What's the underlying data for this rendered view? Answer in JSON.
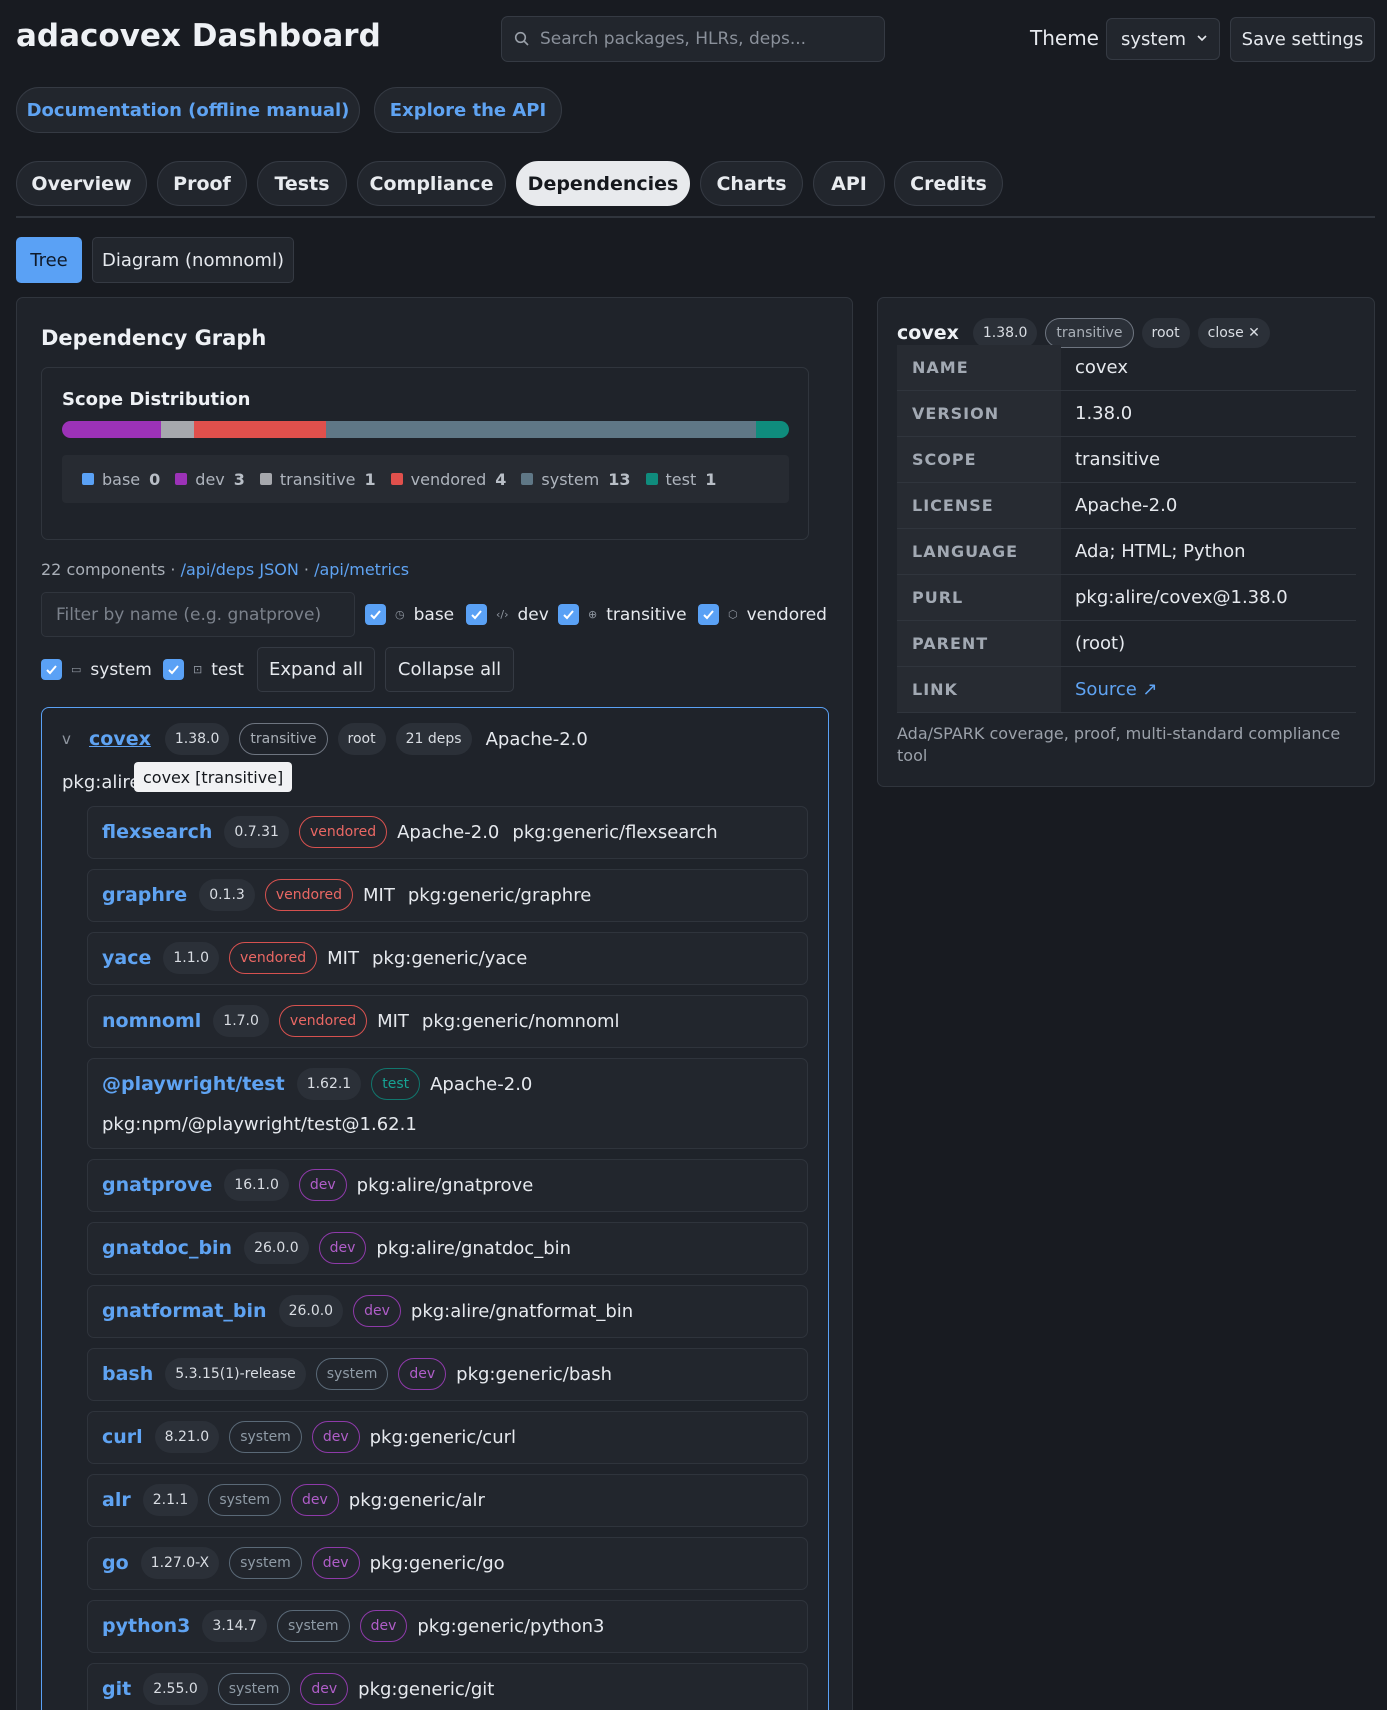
{
  "header": {
    "title": "adacovex Dashboard",
    "search_placeholder": "Search packages, HLRs, deps...",
    "theme_label": "Theme",
    "theme_value": "system",
    "save_label": "Save settings"
  },
  "links": {
    "docs": "Documentation (offline manual)",
    "api": "Explore the API"
  },
  "tabs": [
    "Overview",
    "Proof",
    "Tests",
    "Compliance",
    "Dependencies",
    "Charts",
    "API",
    "Credits"
  ],
  "active_tab": "Dependencies",
  "subtabs": [
    "Tree",
    "Diagram (nomnoml)"
  ],
  "graph": {
    "title": "Dependency Graph",
    "scope_title": "Scope Distribution",
    "scopes": [
      {
        "name": "base",
        "count": "0",
        "color": "#5aa1f5"
      },
      {
        "name": "dev",
        "count": "3",
        "color": "#9c32b8"
      },
      {
        "name": "transitive",
        "count": "1",
        "color": "#a6a8ad"
      },
      {
        "name": "vendored",
        "count": "4",
        "color": "#e0504c"
      },
      {
        "name": "system",
        "count": "13",
        "color": "#5f7786"
      },
      {
        "name": "test",
        "count": "1",
        "color": "#0f8c7d"
      }
    ],
    "components_text": "22 components",
    "sep": "·",
    "deps_json_link": "/api/deps JSON",
    "metrics_link": "/api/metrics",
    "filter_placeholder": "Filter by name (e.g. gnatprove)",
    "filters": [
      "base",
      "dev",
      "transitive",
      "vendored",
      "system",
      "test"
    ],
    "expand_label": "Expand all",
    "collapse_label": "Collapse all"
  },
  "root": {
    "caret": "v",
    "name": "covex",
    "version": "1.38.0",
    "scope": "transitive",
    "role": "root",
    "deps": "21 deps",
    "license": "Apache-2.0",
    "purl": "pkg:alire",
    "tooltip": "covex [transitive]"
  },
  "deps": [
    {
      "name": "flexsearch",
      "version": "0.7.31",
      "chips": [
        "vendored"
      ],
      "license": "Apache-2.0",
      "purl": "pkg:generic/flexsearch"
    },
    {
      "name": "graphre",
      "version": "0.1.3",
      "chips": [
        "vendored"
      ],
      "license": "MIT",
      "purl": "pkg:generic/graphre"
    },
    {
      "name": "yace",
      "version": "1.1.0",
      "chips": [
        "vendored"
      ],
      "license": "MIT",
      "purl": "pkg:generic/yace"
    },
    {
      "name": "nomnoml",
      "version": "1.7.0",
      "chips": [
        "vendored"
      ],
      "license": "MIT",
      "purl": "pkg:generic/nomnoml"
    },
    {
      "name": "@playwright/test",
      "version": "1.62.1",
      "chips": [
        "test"
      ],
      "license": "Apache-2.0",
      "purl": "pkg:npm/@playwright/test@1.62.1"
    },
    {
      "name": "gnatprove",
      "version": "16.1.0",
      "chips": [
        "dev"
      ],
      "license": "",
      "purl": "pkg:alire/gnatprove"
    },
    {
      "name": "gnatdoc_bin",
      "version": "26.0.0",
      "chips": [
        "dev"
      ],
      "license": "",
      "purl": "pkg:alire/gnatdoc_bin"
    },
    {
      "name": "gnatformat_bin",
      "version": "26.0.0",
      "chips": [
        "dev"
      ],
      "license": "",
      "purl": "pkg:alire/gnatformat_bin"
    },
    {
      "name": "bash",
      "version": "5.3.15(1)-release",
      "chips": [
        "system",
        "dev"
      ],
      "license": "",
      "purl": "pkg:generic/bash"
    },
    {
      "name": "curl",
      "version": "8.21.0",
      "chips": [
        "system",
        "dev"
      ],
      "license": "",
      "purl": "pkg:generic/curl"
    },
    {
      "name": "alr",
      "version": "2.1.1",
      "chips": [
        "system",
        "dev"
      ],
      "license": "",
      "purl": "pkg:generic/alr"
    },
    {
      "name": "go",
      "version": "1.27.0-X",
      "chips": [
        "system",
        "dev"
      ],
      "license": "",
      "purl": "pkg:generic/go"
    },
    {
      "name": "python3",
      "version": "3.14.7",
      "chips": [
        "system",
        "dev"
      ],
      "license": "",
      "purl": "pkg:generic/python3"
    },
    {
      "name": "git",
      "version": "2.55.0",
      "chips": [
        "system",
        "dev"
      ],
      "license": "",
      "purl": "pkg:generic/git"
    }
  ],
  "detail": {
    "name": "covex",
    "version": "1.38.0",
    "scope": "transitive",
    "role": "root",
    "close": "close ✕",
    "rows": [
      {
        "k": "NAME",
        "v": "covex"
      },
      {
        "k": "VERSION",
        "v": "1.38.0"
      },
      {
        "k": "SCOPE",
        "v": "transitive"
      },
      {
        "k": "LICENSE",
        "v": "Apache-2.0"
      },
      {
        "k": "LANGUAGE",
        "v": "Ada; HTML; Python"
      },
      {
        "k": "PURL",
        "v": "pkg:alire/covex@1.38.0"
      },
      {
        "k": "PARENT",
        "v": "(root)"
      },
      {
        "k": "LINK",
        "v": "Source ↗"
      }
    ],
    "description": "Ada/SPARK coverage, proof, multi-standard compliance tool"
  }
}
